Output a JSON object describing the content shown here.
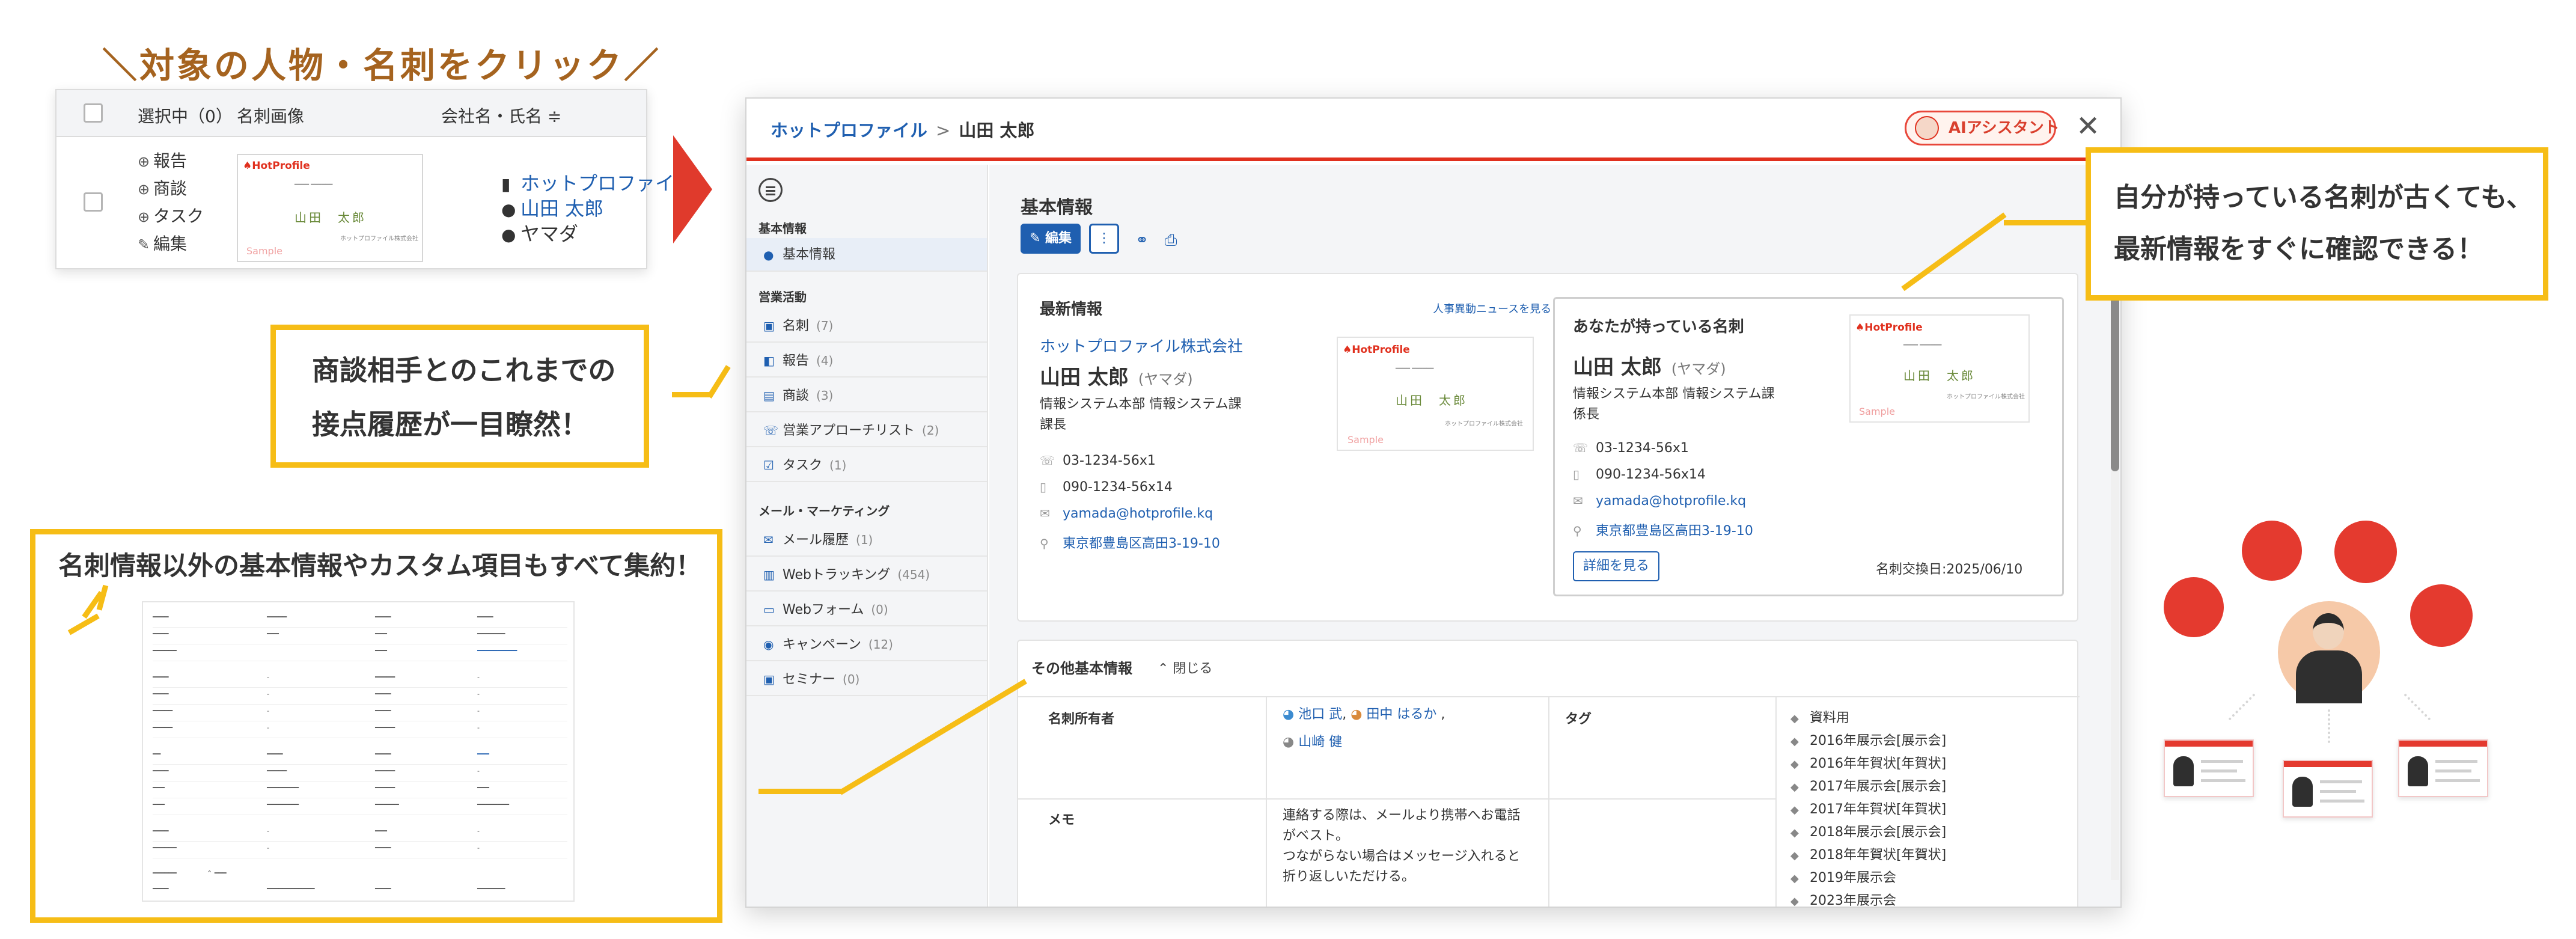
{
  "headline": "＼対象の人物・名刺をクリック／",
  "mini_list": {
    "col_selected": "選択中（0）",
    "col_image": "名刺画像",
    "col_company": "会社名・氏名 ≑",
    "actions": [
      "報告",
      "商談",
      "タスク",
      "編集"
    ],
    "company_link": "ホットプロファイル",
    "person_link": "山田 太郎",
    "kana": "ヤマダ"
  },
  "callouts": {
    "history": [
      "商談相手とのこれまでの",
      "接点履歴が一目瞭然！"
    ],
    "custom": "名刺情報以外の基本情報やカスタム項目もすべて集約！",
    "latest": [
      "自分が持っている名刺が古くても、",
      "最新情報をすぐに確認できる！"
    ]
  },
  "window": {
    "breadcrumb_link": "ホットプロファイル",
    "breadcrumb_sep": ">",
    "breadcrumb_current": "山田 太郎",
    "ai_button": "AIアシスタント",
    "close": "✕"
  },
  "sidebar": {
    "section_basic": "基本情報",
    "basic_item": "基本情報",
    "section_sales": "営業活動",
    "sales_items": [
      {
        "label": "名刺",
        "count": "(7)"
      },
      {
        "label": "報告",
        "count": "(4)"
      },
      {
        "label": "商談",
        "count": "(3)"
      },
      {
        "label": "営業アプローチリスト",
        "count": "(2)"
      },
      {
        "label": "タスク",
        "count": "(1)"
      }
    ],
    "section_marketing": "メール・マーケティング",
    "marketing_items": [
      {
        "label": "メール履歴",
        "count": "(1)"
      },
      {
        "label": "Webトラッキング",
        "count": "(454)"
      },
      {
        "label": "Webフォーム",
        "count": "(0)"
      },
      {
        "label": "キャンペーン",
        "count": "(12)"
      },
      {
        "label": "セミナー",
        "count": "(0)"
      }
    ]
  },
  "main": {
    "title": "基本情報",
    "edit_label": "✎ 編集",
    "more_label": "⋮"
  },
  "latest": {
    "title": "最新情報",
    "news_link": "人事異動ニュースを見る",
    "company": "ホットプロファイル株式会社",
    "name": "山田 太郎",
    "kana": "(ヤマダ)",
    "dept": [
      "情報システム本部 情報システム課",
      "課長"
    ],
    "phone": "03-1234-56x1",
    "mobile": "090-1234-56x14",
    "email": "yamada@hotprofile.kq",
    "address": "東京都豊島区高田3-19-10"
  },
  "owned": {
    "title": "あなたが持っている名刺",
    "name": "山田 太郎",
    "kana": "(ヤマダ)",
    "dept": [
      "情報システム本部 情報システム課",
      "係長"
    ],
    "phone": "03-1234-56x1",
    "mobile": "090-1234-56x14",
    "email": "yamada@hotprofile.kq",
    "address": "東京都豊島区高田3-19-10",
    "detail_button": "詳細を見る",
    "exchange_date": "名刺交換日:2025/06/10"
  },
  "card_art": {
    "logo": "♠HotProfile",
    "name": "山田　太郎",
    "company": "ホットプロファイル株式会社",
    "sample": "Sample"
  },
  "other": {
    "title": "その他基本情報",
    "toggle": "⌃ 閉じる",
    "owner_label": "名刺所有者",
    "owners_line1a": "池口 武",
    "owners_line1b": "田中 はるか",
    "owners_line2": "山崎 健",
    "memo_label": "メモ",
    "memo": [
      "連絡する際は、メールより携帯へお電話",
      "がベスト。",
      "つながらない場合はメッセージ入れると",
      "折り返しいただける。"
    ],
    "tag_label": "タグ",
    "tags": [
      "資料用",
      "2016年展示会[展示会]",
      "2016年年賀状[年賀状]",
      "2017年展示会[展示会]",
      "2017年年賀状[年賀状]",
      "2018年展示会[展示会]",
      "2018年年賀状[年賀状]",
      "2019年展示会",
      "2023年展示会"
    ]
  },
  "accent_colors": {
    "brand_red": "#e0301e",
    "callout_yellow": "#f6bd16",
    "link_blue": "#1f5fb0"
  }
}
